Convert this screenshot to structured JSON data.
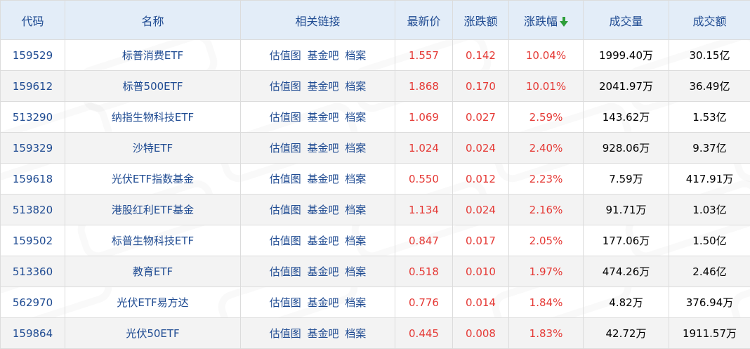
{
  "headers": [
    "代码",
    "名称",
    "相关链接",
    "最新价",
    "涨跌额",
    "涨跌幅",
    "成交量",
    "成交额"
  ],
  "sort_icon": "sort-down-arrow-icon",
  "colors": {
    "header_bg": "#e3edf8",
    "header_text": "#1f4b92",
    "link": "#1f4b92",
    "up": "#e53935",
    "arrow": "#2e9e3a"
  },
  "links": [
    "估值图",
    "基金吧",
    "档案"
  ],
  "rows": [
    {
      "code": "159529",
      "name": "标普消费ETF",
      "price": "1.557",
      "change": "0.142",
      "pct": "10.04%",
      "volume": "1999.40万",
      "amount": "30.15亿"
    },
    {
      "code": "159612",
      "name": "标普500ETF",
      "price": "1.868",
      "change": "0.170",
      "pct": "10.01%",
      "volume": "2041.97万",
      "amount": "36.49亿"
    },
    {
      "code": "513290",
      "name": "纳指生物科技ETF",
      "price": "1.069",
      "change": "0.027",
      "pct": "2.59%",
      "volume": "143.62万",
      "amount": "1.53亿"
    },
    {
      "code": "159329",
      "name": "沙特ETF",
      "price": "1.024",
      "change": "0.024",
      "pct": "2.40%",
      "volume": "928.06万",
      "amount": "9.37亿"
    },
    {
      "code": "159618",
      "name": "光伏ETF指数基金",
      "price": "0.550",
      "change": "0.012",
      "pct": "2.23%",
      "volume": "7.59万",
      "amount": "417.91万"
    },
    {
      "code": "513820",
      "name": "港股红利ETF基金",
      "price": "1.134",
      "change": "0.024",
      "pct": "2.16%",
      "volume": "91.71万",
      "amount": "1.03亿"
    },
    {
      "code": "159502",
      "name": "标普生物科技ETF",
      "price": "0.847",
      "change": "0.017",
      "pct": "2.05%",
      "volume": "177.06万",
      "amount": "1.50亿"
    },
    {
      "code": "513360",
      "name": "教育ETF",
      "price": "0.518",
      "change": "0.010",
      "pct": "1.97%",
      "volume": "474.26万",
      "amount": "2.46亿"
    },
    {
      "code": "562970",
      "name": "光伏ETF易方达",
      "price": "0.776",
      "change": "0.014",
      "pct": "1.84%",
      "volume": "4.82万",
      "amount": "376.94万"
    },
    {
      "code": "159864",
      "name": "光伏50ETF",
      "price": "0.445",
      "change": "0.008",
      "pct": "1.83%",
      "volume": "42.72万",
      "amount": "1911.57万"
    }
  ]
}
